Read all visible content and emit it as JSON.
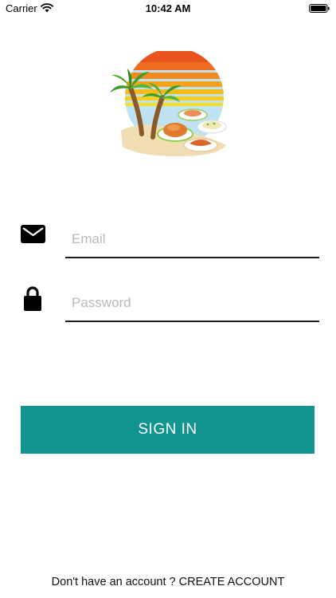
{
  "status_bar": {
    "carrier": "Carrier",
    "time": "10:42 AM",
    "icons": [
      "wifi-icon",
      "battery-icon"
    ]
  },
  "logo": {
    "icon": "tropical-food-logo",
    "colors": {
      "sun_top": "#e94d1f",
      "sun_mid": "#f39c12",
      "sun_low": "#f7d21a",
      "sky": "#bfe3f2",
      "sand": "#f1ddb3",
      "palm": "#3f9b2a"
    }
  },
  "email": {
    "icon": "mail-icon",
    "placeholder": "Email",
    "value": ""
  },
  "password": {
    "icon": "lock-icon",
    "placeholder": "Password",
    "value": ""
  },
  "sign_in": {
    "label": "SIGN IN",
    "color": "#129490"
  },
  "footer": {
    "prompt": "Don't have an account ? ",
    "link_label": "CREATE ACCOUNT"
  }
}
